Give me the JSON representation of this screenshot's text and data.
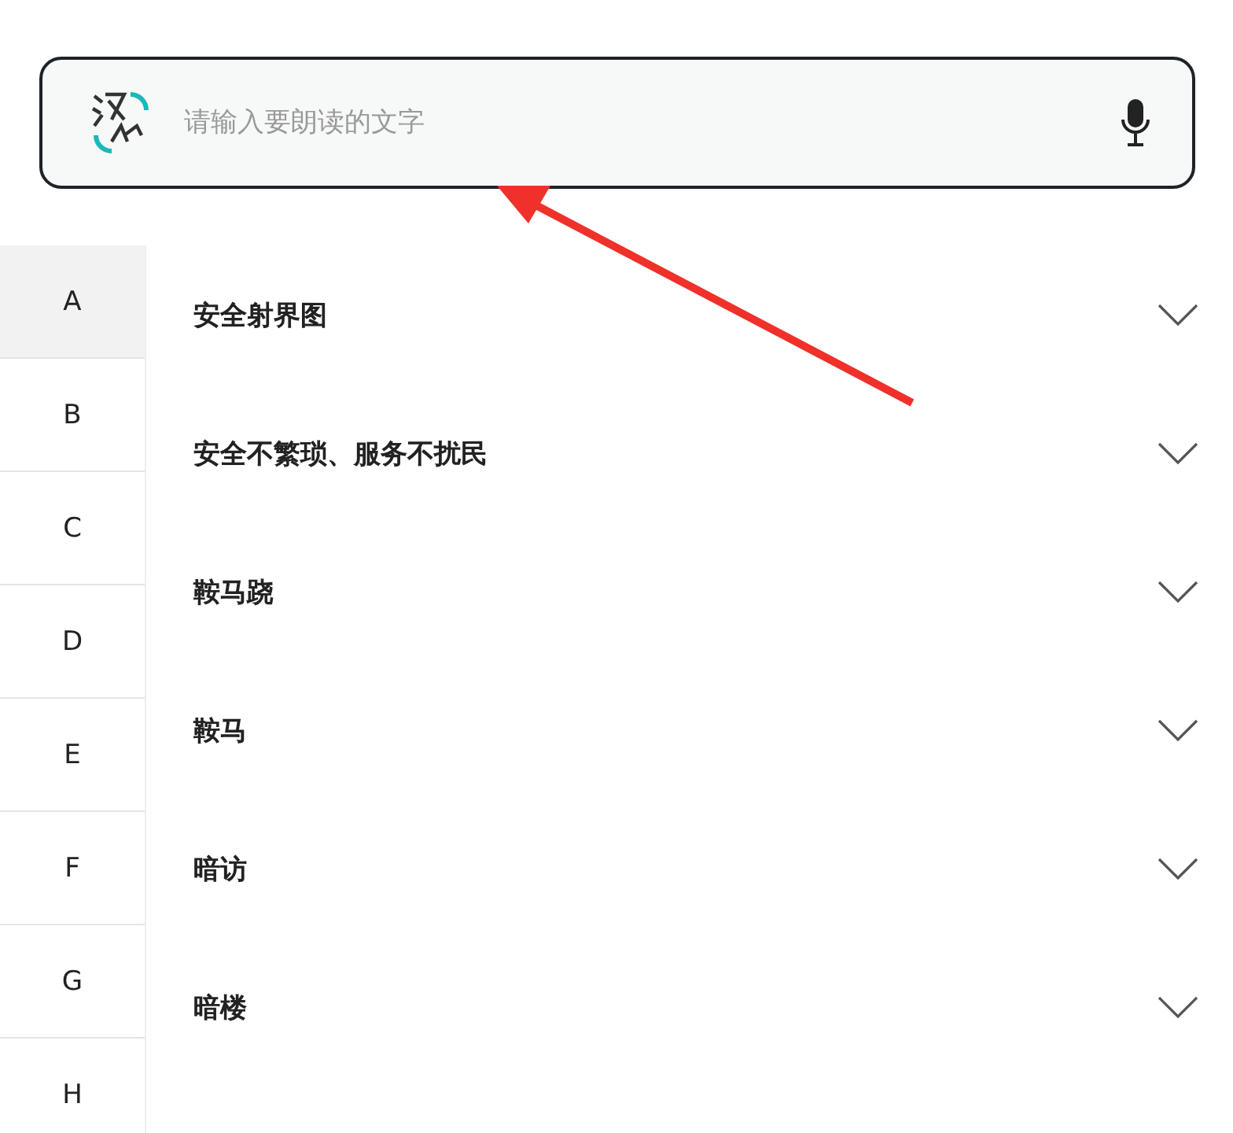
{
  "search": {
    "placeholder": "请输入要朗读的文字"
  },
  "index": [
    {
      "label": "A",
      "selected": true
    },
    {
      "label": "B",
      "selected": false
    },
    {
      "label": "C",
      "selected": false
    },
    {
      "label": "D",
      "selected": false
    },
    {
      "label": "E",
      "selected": false
    },
    {
      "label": "F",
      "selected": false
    },
    {
      "label": "G",
      "selected": false
    },
    {
      "label": "H",
      "selected": false
    }
  ],
  "entries": [
    {
      "label": "安全射界图",
      "expanded": false
    },
    {
      "label": "安全不繁琐、服务不扰民",
      "expanded": false
    },
    {
      "label": "鞍马跷",
      "expanded": false
    },
    {
      "label": "鞍马",
      "expanded": false
    },
    {
      "label": "暗访",
      "expanded": false
    },
    {
      "label": "暗楼",
      "expanded": false
    }
  ]
}
